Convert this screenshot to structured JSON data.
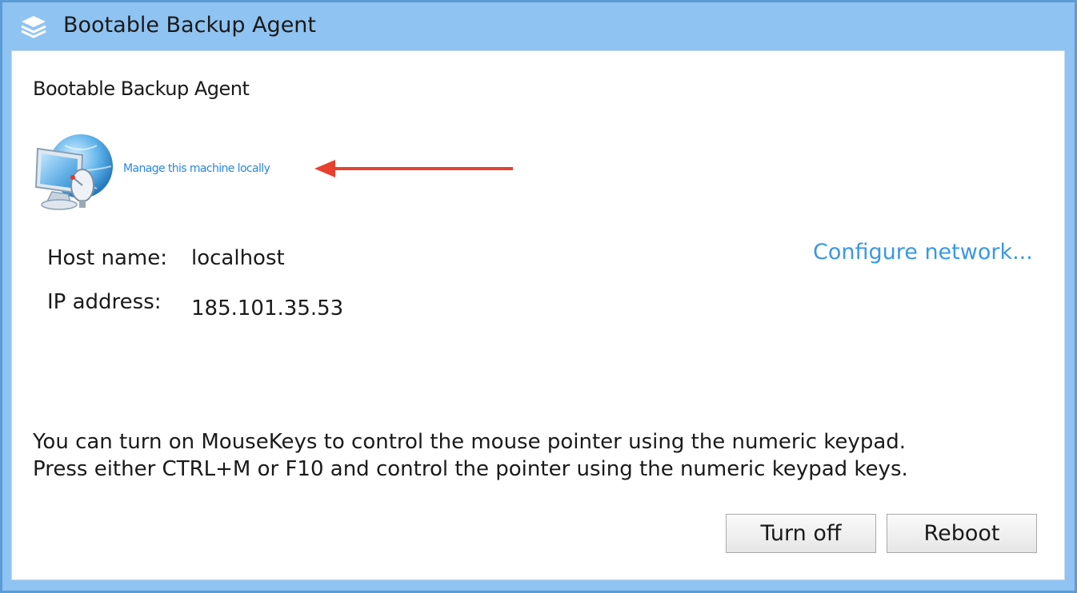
{
  "window": {
    "title": "Bootable Backup Agent",
    "title_icon": "layers-icon"
  },
  "main": {
    "heading": "Bootable Backup Agent",
    "machine_icon": "computer-globe-icon",
    "manage_link": "Manage this machine locally",
    "annotation_arrow": "red-arrow-icon",
    "host_label": "Host name:",
    "host_value": "localhost",
    "ip_label": "IP address:",
    "ip_value": "185.101.35.53",
    "configure_link": "Configure network...",
    "info_line1": "You can turn on MouseKeys to control the mouse pointer using the numeric keypad.",
    "info_line2": "Press either CTRL+M or F10 and control the pointer using the numeric keypad keys."
  },
  "buttons": {
    "turn_off": "Turn off",
    "reboot": "Reboot"
  },
  "colors": {
    "titlebar": "#8fc3f1",
    "link": "#3a97e6",
    "arrow": "#e8412f"
  }
}
